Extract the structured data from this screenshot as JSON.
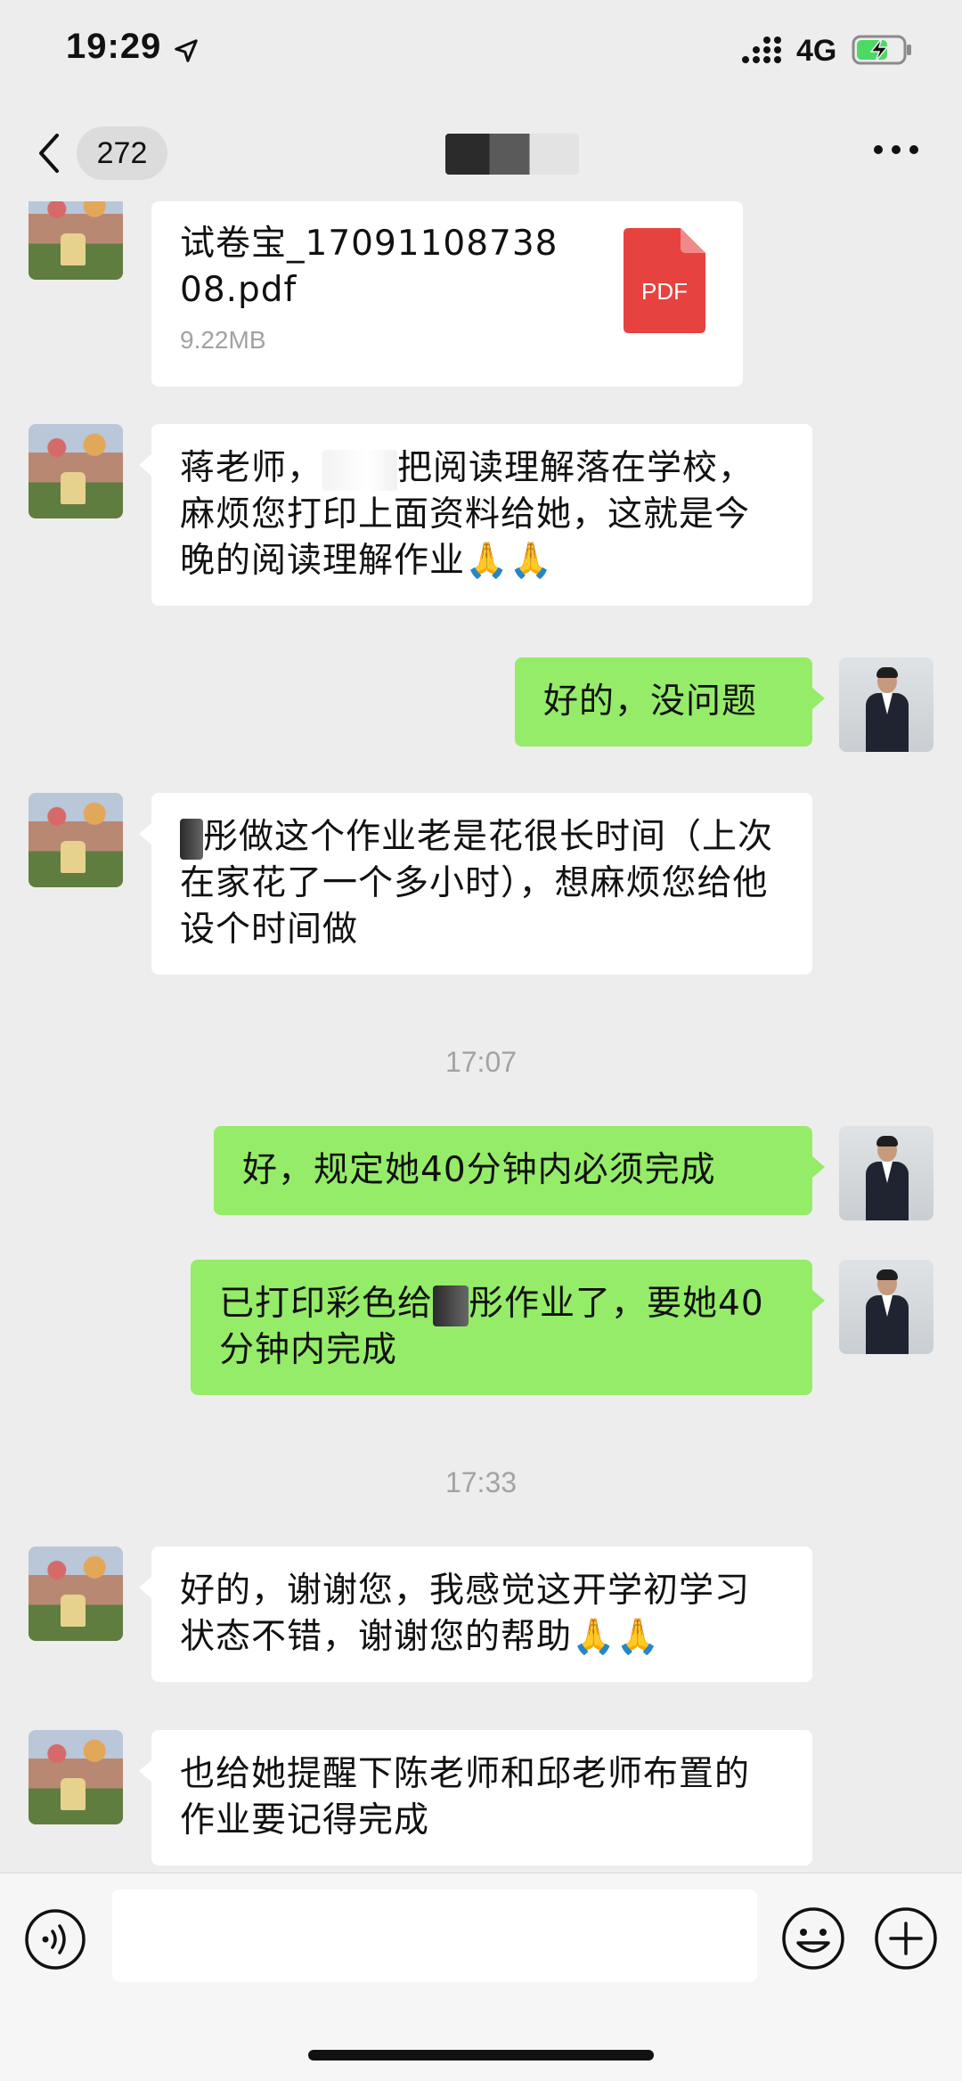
{
  "status_bar": {
    "time": "19:29",
    "network": "4G"
  },
  "nav": {
    "unread_count": "272"
  },
  "messages": {
    "m1_file": {
      "file_name": "试卷宝_1709110873808.pdf",
      "file_size": "9.22MB",
      "icon_label": "PDF"
    },
    "m2": {
      "part1": "蒋老师，",
      "part2": "把阅读理解落在学校，麻烦您打印上面资料给她，这就是今晚的阅读理解作业🙏🙏"
    },
    "m3": {
      "text": "好的，没问题"
    },
    "m4": {
      "text": "彤做这个作业老是花很长时间（上次在家花了一个多小时），想麻烦您给他设个时间做"
    },
    "ts1": "17:07",
    "m5": {
      "text": "好，规定她40分钟内必须完成"
    },
    "m6": {
      "part1": "已打印彩色给",
      "part2": "彤作业了，要她40分钟内完成"
    },
    "ts2": "17:33",
    "m7": {
      "text": "好的，谢谢您，我感觉这开学初学习状态不错，谢谢您的帮助🙏🙏"
    },
    "m8": {
      "text": "也给她提醒下陈老师和邱老师布置的作业要记得完成"
    }
  },
  "colors": {
    "background": "#ededed",
    "outgoing_bubble": "#95ec69",
    "incoming_bubble": "#ffffff",
    "pdf_red": "#e64340",
    "battery_green": "#4cd964"
  },
  "icons": [
    "location-arrow-icon",
    "signal-icon",
    "battery-charging-icon",
    "back-chevron-icon",
    "more-icon",
    "pdf-file-icon",
    "voice-icon",
    "emoji-icon",
    "plus-icon"
  ]
}
